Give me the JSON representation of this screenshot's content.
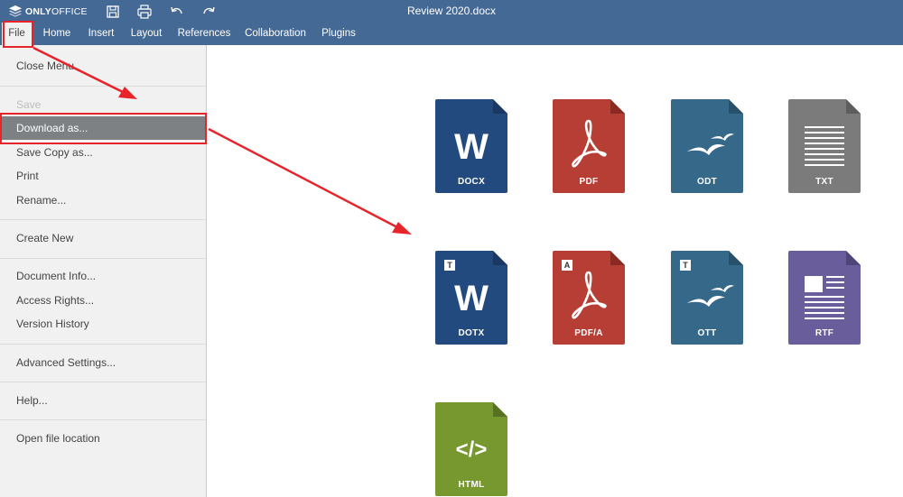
{
  "app": {
    "logo_text_bold": "ONLY",
    "logo_text_thin": "OFFICE",
    "document_title": "Review 2020.docx"
  },
  "colors": {
    "header_bg": "#446995",
    "menu_bg": "#f1f1f1",
    "selected_bg": "#7e8184",
    "highlight": "#e8242b"
  },
  "tabs": [
    {
      "label": "File",
      "active": true
    },
    {
      "label": "Home"
    },
    {
      "label": "Insert"
    },
    {
      "label": "Layout"
    },
    {
      "label": "References"
    },
    {
      "label": "Collaboration"
    },
    {
      "label": "Plugins"
    }
  ],
  "file_menu": {
    "close": "Close Menu",
    "save": "Save",
    "download_as": "Download as...",
    "save_copy_as": "Save Copy as...",
    "print": "Print",
    "rename": "Rename...",
    "create_new": "Create New",
    "document_info": "Document Info...",
    "access_rights": "Access Rights...",
    "version_history": "Version History",
    "advanced_settings": "Advanced Settings...",
    "help": "Help...",
    "open_file_location": "Open file location"
  },
  "formats": [
    {
      "label": "DOCX",
      "color": "#234a7f",
      "icon": "word-icon"
    },
    {
      "label": "PDF",
      "color": "#b73e34",
      "icon": "acrobat-icon"
    },
    {
      "label": "ODT",
      "color": "#366889",
      "icon": "openoffice-gulls-icon"
    },
    {
      "label": "TXT",
      "color": "#7b7b7b",
      "icon": "text-lines-icon"
    },
    {
      "label": "DOTX",
      "badge": "T",
      "color": "#234a7f",
      "icon": "word-icon"
    },
    {
      "label": "PDF/A",
      "badge": "A",
      "color": "#b73e34",
      "icon": "acrobat-icon"
    },
    {
      "label": "OTT",
      "badge": "T",
      "color": "#366889",
      "icon": "openoffice-gulls-icon"
    },
    {
      "label": "RTF",
      "color": "#6a5d9b",
      "icon": "rtf-page-icon"
    },
    {
      "label": "HTML",
      "color": "#76982f",
      "icon": "code-brackets-icon"
    }
  ]
}
